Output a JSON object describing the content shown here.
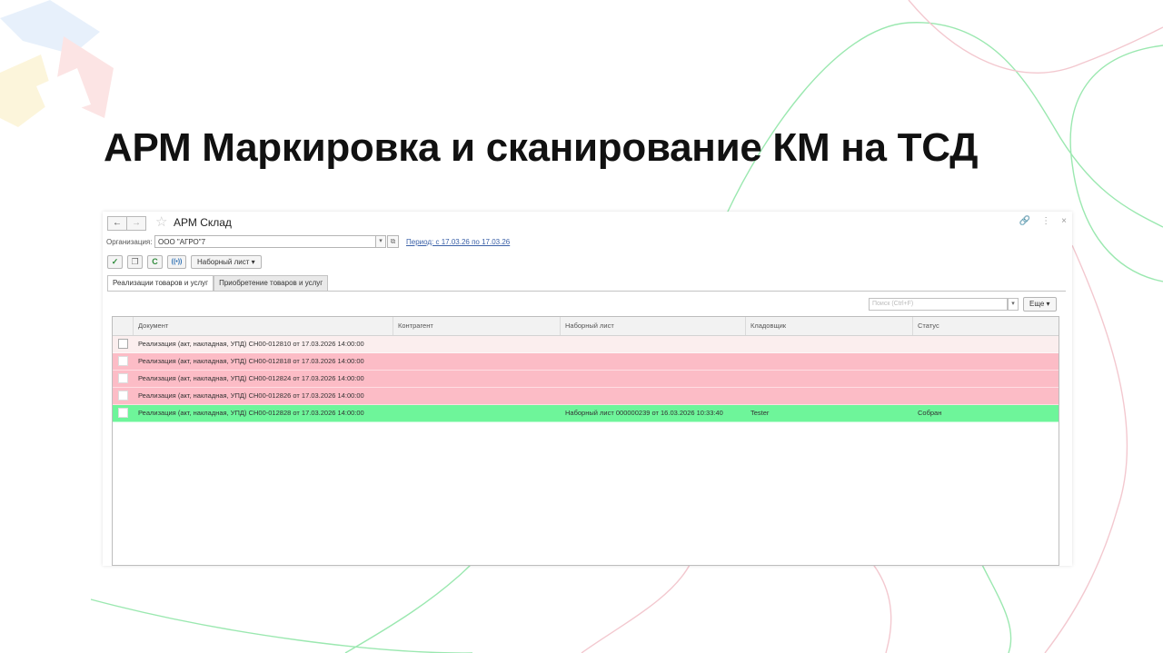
{
  "slide": {
    "title": "АРМ Маркировка и сканирование КМ на ТСД"
  },
  "window": {
    "nav_back": "←",
    "nav_forward": "→",
    "title": "АРМ Склад",
    "controls": [
      "🔗",
      "⋮",
      "×"
    ]
  },
  "organization": {
    "label": "Организация:",
    "value": "ООО \"АГРО\"7",
    "dropdown_glyph": "▾",
    "open_glyph": "⧉"
  },
  "period_link": "Период: с 17.03.26 по 17.03.26",
  "toolbar": {
    "icons": [
      "check-icon",
      "copy-icon",
      "refresh-icon",
      "radio-icon"
    ],
    "glyphs": [
      "✓",
      "❐",
      "C",
      "((•))"
    ],
    "picklist_button": "Наборный лист ▾"
  },
  "tabs": [
    {
      "label": "Реализации товаров и услуг",
      "active": true
    },
    {
      "label": "Приобретение товаров и услуг",
      "active": false
    }
  ],
  "search": {
    "placeholder": "Поиск (Ctrl+F)",
    "dropdown_glyph": "▾",
    "more_button": "Еще ▾"
  },
  "table": {
    "columns": [
      "",
      "Документ",
      "Контрагент",
      "Наборный лист",
      "Кладовщик",
      "Статус"
    ],
    "rows": [
      {
        "document": "Реализация (акт, накладная, УПД) СН00-012810 от 17.03.2026 14:00:00",
        "counterparty": "",
        "picklist": "",
        "storekeeper": "",
        "status": "",
        "state": "white"
      },
      {
        "document": "Реализация (акт, накладная, УПД) СН00-012818 от 17.03.2026 14:00:00",
        "counterparty": "",
        "picklist": "",
        "storekeeper": "",
        "status": "",
        "state": "red"
      },
      {
        "document": "Реализация (акт, накладная, УПД) СН00-012824 от 17.03.2026 14:00:00",
        "counterparty": "",
        "picklist": "",
        "storekeeper": "",
        "status": "",
        "state": "red"
      },
      {
        "document": "Реализация (акт, накладная, УПД) СН00-012826 от 17.03.2026 14:00:00",
        "counterparty": "",
        "picklist": "",
        "storekeeper": "",
        "status": "",
        "state": "red"
      },
      {
        "document": "Реализация (акт, накладная, УПД) СН00-012828 от 17.03.2026 14:00:00",
        "counterparty": "",
        "picklist": "Наборный лист 000000239 от 16.03.2026 10:33:40",
        "storekeeper": "Tester",
        "status": "Собран",
        "state": "green"
      }
    ]
  },
  "colors": {
    "row_white": "#fbeeee",
    "row_red": "#fcbcc6",
    "row_green": "#6ef59a",
    "link": "#3b61a8",
    "decor_green": "#8fe6a7",
    "decor_pink": "#f7c6d0"
  }
}
